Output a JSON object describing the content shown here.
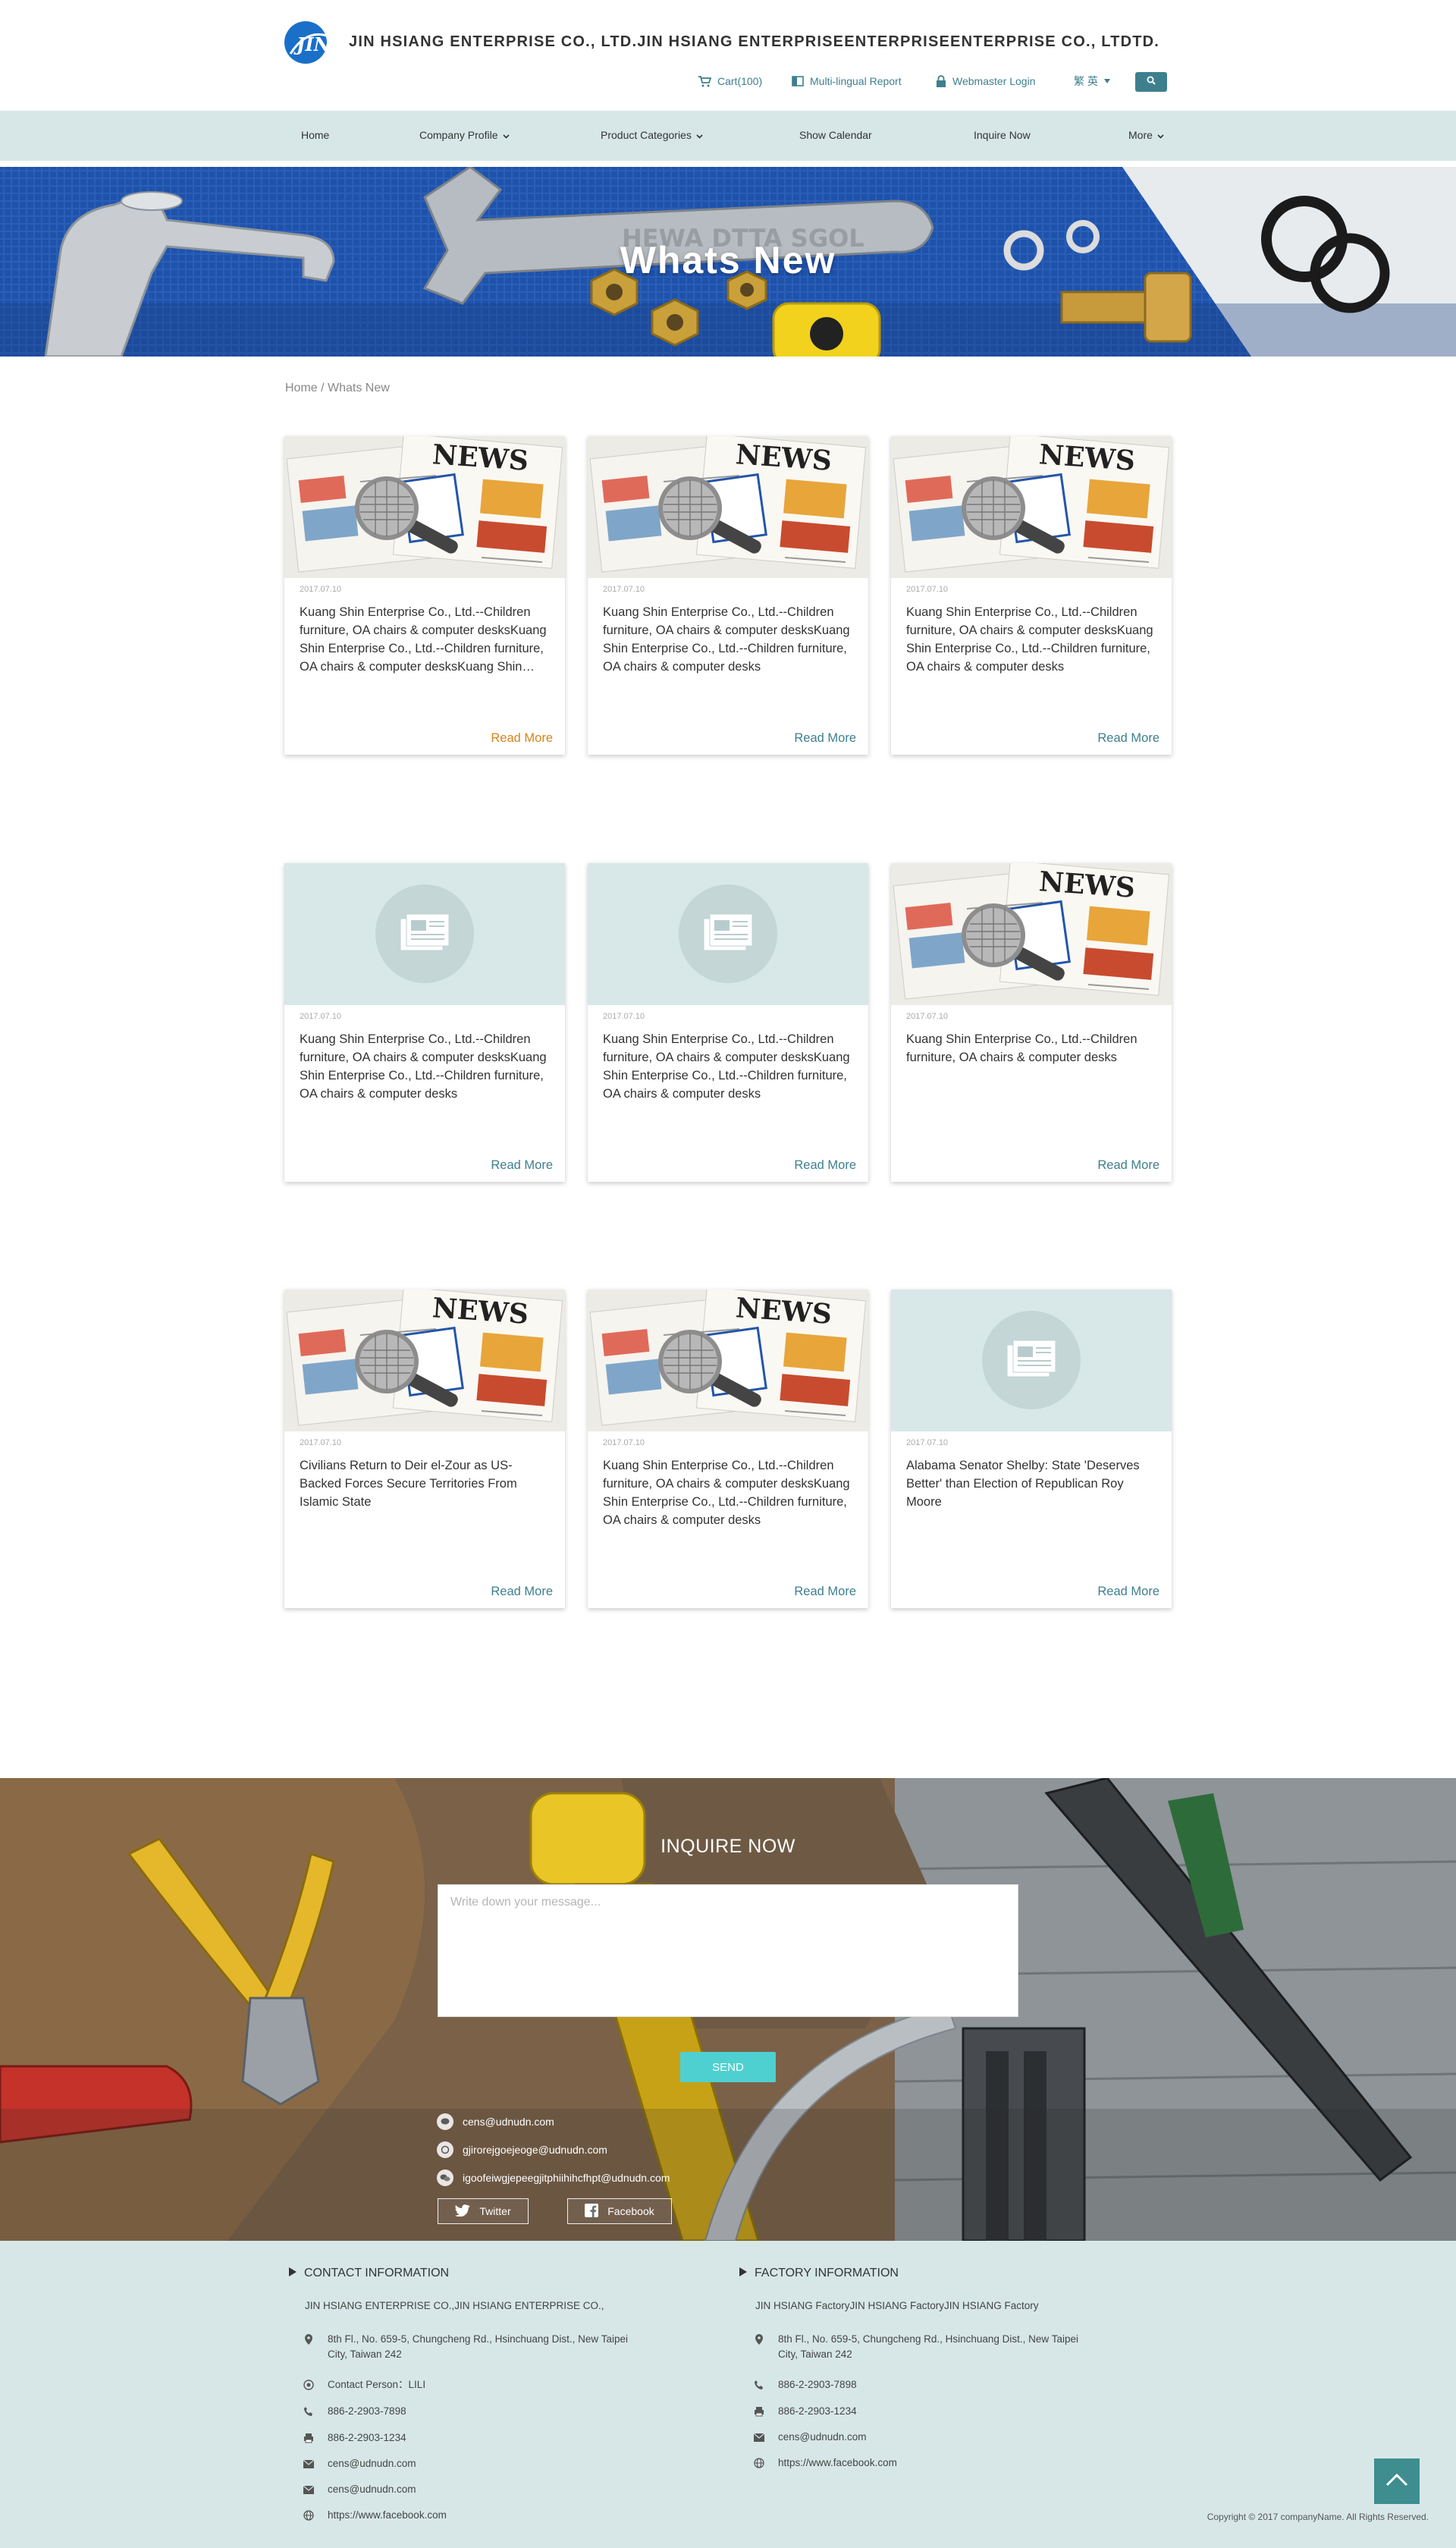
{
  "header": {
    "company_name": "JIN HSIANG ENTERPRISE CO., LTD.JIN HSIANG ENTERPRISEENTERPRISEENTERPRISE CO., LTDTD.",
    "cart": "Cart(100)",
    "report": "Multi-lingual Report",
    "login": "Webmaster Login",
    "language": "繁 英"
  },
  "nav": {
    "items": [
      {
        "label": "Home"
      },
      {
        "label": "Company Profile"
      },
      {
        "label": "Product Categories"
      },
      {
        "label": "Show Calendar"
      },
      {
        "label": "Inquire Now"
      },
      {
        "label": "More"
      }
    ]
  },
  "banner": {
    "title": "Whats New"
  },
  "breadcrumb": {
    "text": "Home / Whats New"
  },
  "news": [
    {
      "date": "2017.07.10",
      "title": "Kuang Shin Enterprise Co., Ltd.--Children furniture, OA chairs & computer desksKuang Shin Enterprise Co., Ltd.--Children furniture, OA chairs & computer desksKuang Shin…",
      "more": "Read More"
    },
    {
      "date": "2017.07.10",
      "title": "Kuang Shin Enterprise Co., Ltd.--Children furniture, OA chairs & computer desksKuang Shin Enterprise Co., Ltd.--Children furniture, OA chairs & computer desks",
      "more": "Read More"
    },
    {
      "date": "2017.07.10",
      "title": "Kuang Shin Enterprise Co., Ltd.--Children furniture, OA chairs & computer desksKuang Shin Enterprise Co., Ltd.--Children furniture, OA chairs & computer desks",
      "more": "Read More"
    },
    {
      "date": "2017.07.10",
      "title": "Kuang Shin Enterprise Co., Ltd.--Children furniture, OA chairs & computer desksKuang Shin Enterprise Co., Ltd.--Children furniture, OA chairs & computer desks",
      "more": "Read More"
    },
    {
      "date": "2017.07.10",
      "title": "Kuang Shin Enterprise Co., Ltd.--Children furniture, OA chairs & computer desksKuang Shin Enterprise Co., Ltd.--Children furniture, OA chairs & computer desks",
      "more": "Read More"
    },
    {
      "date": "2017.07.10",
      "title": "Kuang Shin Enterprise Co., Ltd.--Children furniture, OA chairs & computer desks",
      "more": "Read More"
    },
    {
      "date": "2017.07.10",
      "title": "Civilians Return to Deir el-Zour as US-Backed Forces Secure Territories From Islamic State",
      "more": "Read More"
    },
    {
      "date": "2017.07.10",
      "title": "Kuang Shin Enterprise Co., Ltd.--Children furniture, OA chairs & computer desksKuang Shin Enterprise Co., Ltd.--Children furniture, OA chairs & computer desks",
      "more": "Read More"
    },
    {
      "date": "2017.07.10",
      "title": "Alabama Senator Shelby: State 'Deserves Better' than Election of Republican Roy Moore",
      "more": "Read More"
    }
  ],
  "inquire": {
    "title": "INQUIRE NOW",
    "placeholder": "Write down your message...",
    "send": "SEND",
    "contacts": [
      {
        "icon": "line-icon",
        "text": "cens@udnudn.com"
      },
      {
        "icon": "whatsapp-icon",
        "text": "gjirorejgoejeoge@udnudn.com"
      },
      {
        "icon": "wechat-icon",
        "text": "igoofeiwgjepeegjitphiihihcfhpt@udnudn.com"
      }
    ],
    "twitter": "Twitter",
    "facebook": "Facebook"
  },
  "footer": {
    "contact": {
      "heading": "CONTACT INFORMATION",
      "company": "JIN HSIANG ENTERPRISE CO.,JIN HSIANG ENTERPRISE CO.,",
      "address_1": "8th Fl., No. 659-5, Chungcheng Rd., Hsinchuang Dist., New Taipei",
      "address_2": "City, Taiwan 242",
      "person": "Contact Person：LILI",
      "phone": "886-2-2903-7898",
      "fax": "886-2-2903-1234",
      "email_1": "cens@udnudn.com",
      "email_2": "cens@udnudn.com",
      "web": "https://www.facebook.com"
    },
    "factory": {
      "heading": "FACTORY INFORMATION",
      "company": "JIN HSIANG FactoryJIN HSIANG FactoryJIN HSIANG Factory",
      "address_1": "8th Fl., No. 659-5, Chungcheng Rd., Hsinchuang Dist., New Taipei",
      "address_2": "City, Taiwan 242",
      "phone": "886-2-2903-7898",
      "fax": "886-2-2903-1234",
      "email": "cens@udnudn.com",
      "web": "https://www.facebook.com"
    },
    "copyright": "Copyright © 2017 companyName. All Rights Reserved."
  },
  "colors": {
    "accent": "#3e7f8e",
    "nav_bg": "#d7e7e8",
    "send": "#4fd0d0",
    "read_more_active": "#d8841a"
  }
}
